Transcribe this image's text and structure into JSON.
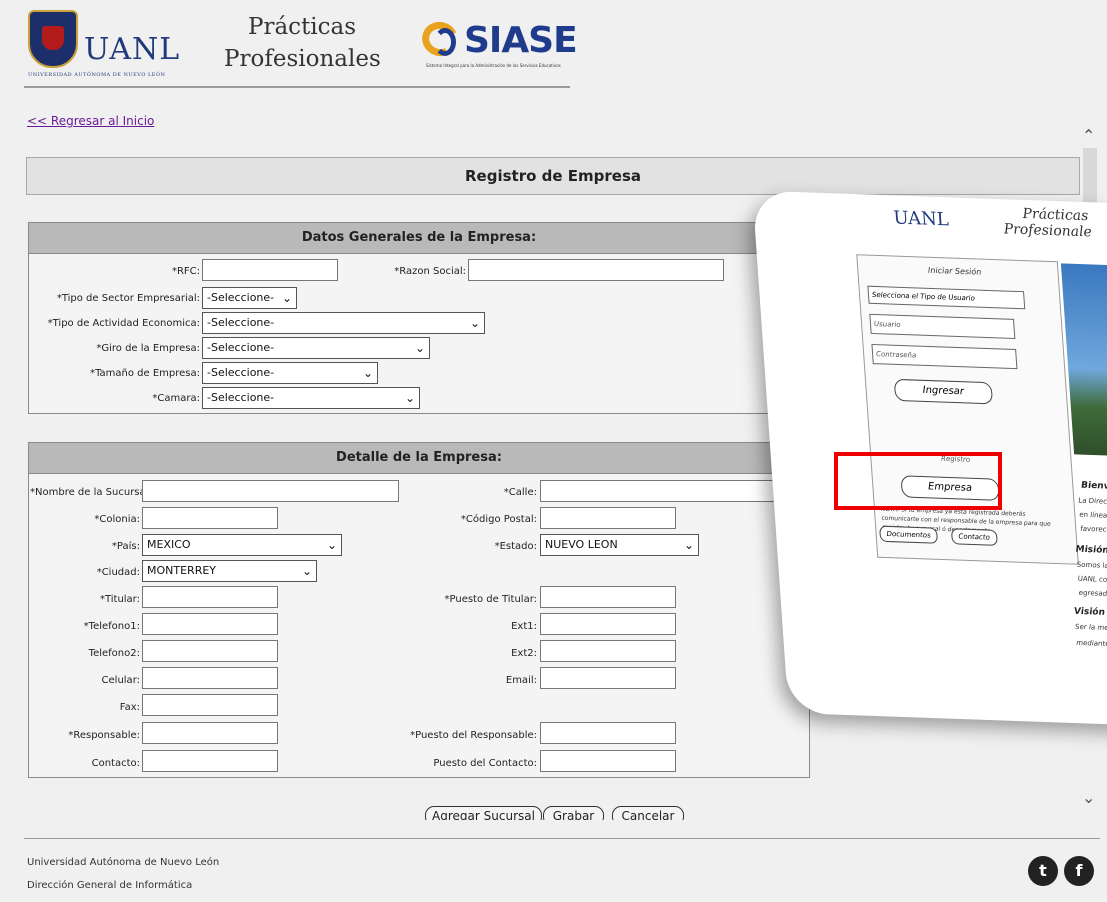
{
  "header": {
    "uanl": "UANL",
    "uanl_sub": "UNIVERSIDAD AUTÓNOMA DE NUEVO LEÓN",
    "pp_line1": "Prácticas",
    "pp_line2": "Profesionales",
    "siase": "SIASE",
    "siase_sub": "Sistema Integral para la Administración de los Servicios Educativos"
  },
  "back_link": "<< Regresar al Inicio",
  "page_title": "Registro de Empresa",
  "datos": {
    "title": "Datos Generales de la Empresa:",
    "rfc": "*RFC:",
    "razon": "*Razon Social:",
    "sector": "*Tipo de Sector Empresarial:",
    "actividad": "*Tipo de Actividad Economica:",
    "giro": "*Giro de la Empresa:",
    "tamano": "*Tamaño de Empresa:",
    "camara": "*Camara:",
    "select_default": "-Seleccione-"
  },
  "detalle": {
    "title": "Detalle de la Empresa:",
    "nombre_sucursal": "*Nombre de la Sucursal:",
    "calle": "*Calle:",
    "colonia": "*Colonia:",
    "codigo_postal": "*Código Postal:",
    "pais": "*País:",
    "pais_value": "MEXICO",
    "estado": "*Estado:",
    "estado_value": "NUEVO LEON",
    "ciudad": "*Ciudad:",
    "ciudad_value": "MONTERREY",
    "titular": "*Titular:",
    "puesto_titular": "*Puesto de Titular:",
    "telefono1": "*Telefono1:",
    "ext1": "Ext1:",
    "telefono2": "Telefono2:",
    "ext2": "Ext2:",
    "celular": "Celular:",
    "email": "Email:",
    "fax": "Fax:",
    "responsable": "*Responsable:",
    "puesto_responsable": "*Puesto del Responsable:",
    "contacto": "Contacto:",
    "puesto_contacto": "Puesto del Contacto:"
  },
  "buttons": {
    "agregar": "Agregar Sucursal",
    "grabar": "Grabar",
    "cancelar": "Cancelar"
  },
  "footer": {
    "line1": "Universidad Autónoma de Nuevo León",
    "line2": "Dirección General de Informática",
    "twitter": "t",
    "facebook": "f"
  },
  "inset": {
    "uanl": "UANL",
    "pp1": "Prácticas",
    "pp2": "Profesionale",
    "iniciar": "Iniciar Sesión",
    "tipo_usuario": "Selecciona el Tipo de Usuario",
    "usuario": "Usuario",
    "contrasena": "Contraseña",
    "ingresar": "Ingresar",
    "registro": "Registro",
    "empresa": "Empresa",
    "nota": "NOTA: Si tu empresa ya esta registrada deberás comunicarte con el responsable de la empresa para que registre tu sucursal ó departamento.",
    "documentos": "Documentos",
    "contacto": "Contacto",
    "bienvenido": "Bienvenidos",
    "t1": "La Dirección de",
    "t2": "en línea como un",
    "t3": "favorecer la relaci",
    "mision": "Misión",
    "t4": "Somos la instancia u",
    "t5": "UANL con los sectore",
    "t6": "egresados.",
    "vision": "Visión",
    "t7": "Ser la mejor instancia un",
    "t8": "mediante acciones de vin"
  },
  "colors": {
    "accent_red": "#ee0000",
    "link": "#6a1b9a",
    "brand_blue": "#1f3b8c"
  }
}
